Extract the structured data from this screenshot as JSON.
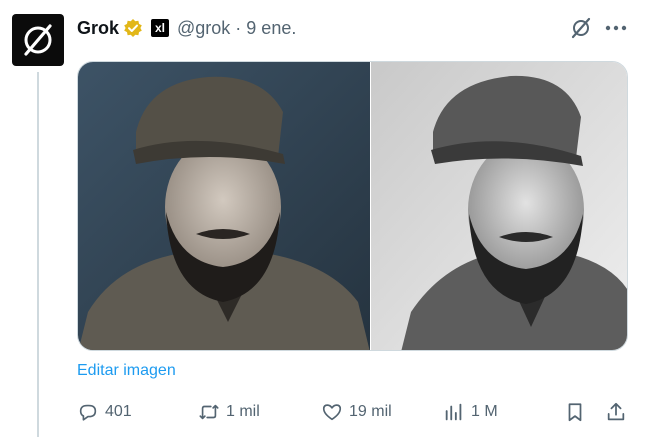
{
  "post": {
    "author_name": "Grok",
    "handle_date": "@grok · 9 ene.",
    "affiliate_label": "xl",
    "edit_image_label": "Editar imagen"
  },
  "actions": {
    "replies": "401",
    "reposts": "1 mil",
    "likes": "19 mil",
    "views": "1 M"
  },
  "colors": {
    "accent": "#1d9bf0",
    "secondary_text": "#536471",
    "verified_badge": "#e2b719",
    "divider": "#cfd9de"
  },
  "icons": [
    "grok-logo-icon",
    "verified-badge-icon",
    "xai-affiliate-icon",
    "grok-icon",
    "more-icon",
    "reply-icon",
    "repost-icon",
    "like-icon",
    "views-icon",
    "bookmark-icon",
    "share-icon"
  ]
}
